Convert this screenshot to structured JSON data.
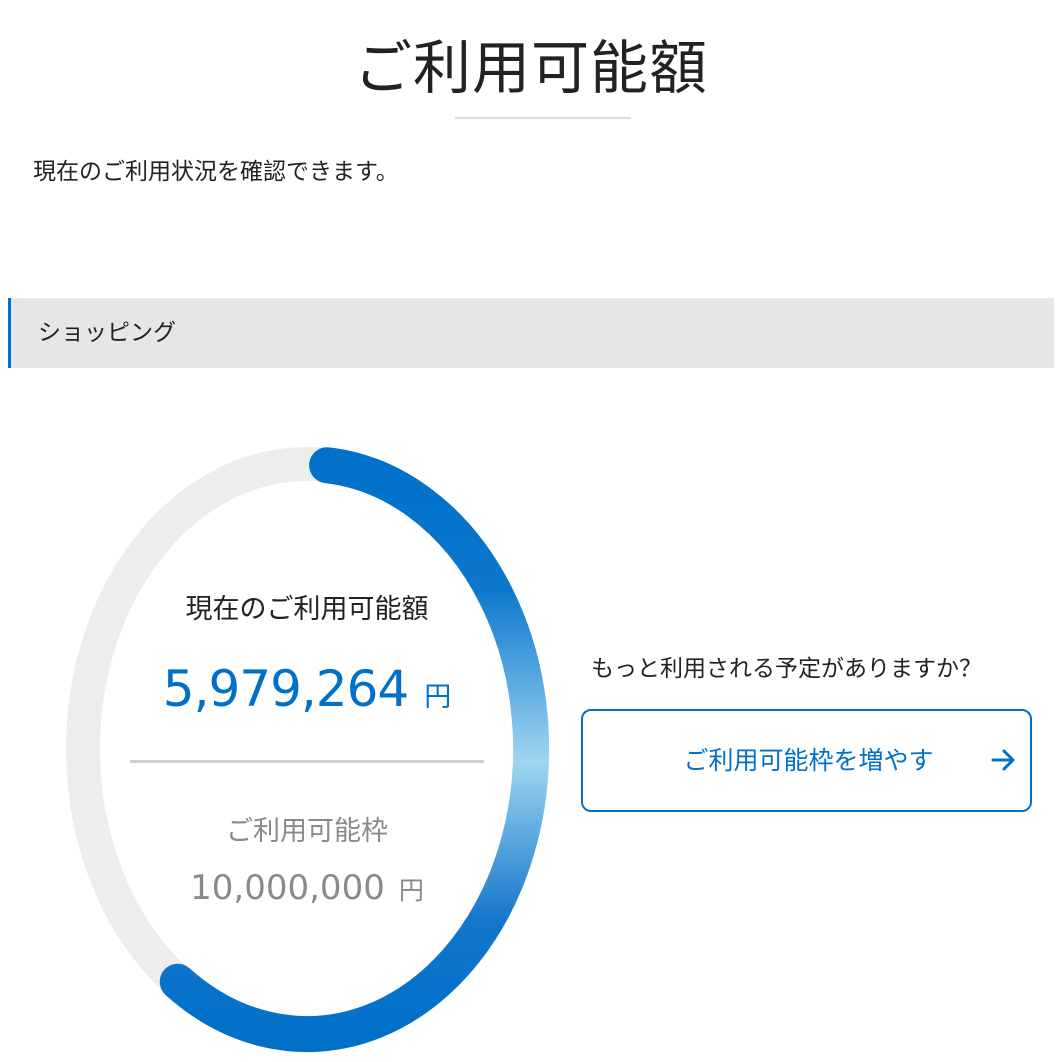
{
  "page": {
    "title": "ご利用可能額",
    "intro": "現在のご利用状況を確認できます。"
  },
  "section": {
    "label": "ショッピング"
  },
  "gauge": {
    "available_label": "現在のご利用可能額",
    "available_value": "5,979,264",
    "available_unit": "円",
    "limit_label": "ご利用可能枠",
    "limit_value": "10,000,000",
    "limit_unit": "円",
    "available_fraction": 0.5979264,
    "colors": {
      "accent": "#0070c9",
      "accent_light": "#9fd6f0",
      "track": "#eceeee"
    }
  },
  "upsell": {
    "question": "もっと利用される予定がありますか？",
    "button_label": "ご利用可能枠を増やす",
    "button_icon": "arrow-right-icon"
  }
}
